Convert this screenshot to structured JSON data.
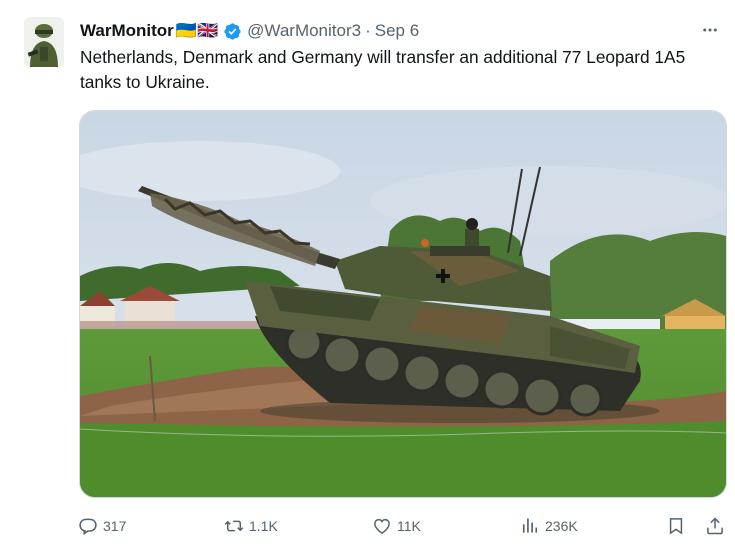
{
  "author": {
    "name": "WarMonitor",
    "flags": "🇺🇦🇬🇧",
    "handle": "@WarMonitor3",
    "separator": "·",
    "date": "Sep 6"
  },
  "tweet": {
    "text": "Netherlands, Denmark and Germany will transfer an additional 77 Leopard 1A5 tanks to Ukraine."
  },
  "metrics": {
    "replies": "317",
    "reposts": "1.1K",
    "likes": "11K",
    "views": "236K"
  },
  "colors": {
    "verified": "#1d9bf0",
    "muted_text": "#536471"
  },
  "icons": {
    "more": "more-icon",
    "reply": "reply-icon",
    "repost": "repost-icon",
    "like": "heart-icon",
    "views": "views-icon",
    "bookmark": "bookmark-icon",
    "share": "share-icon"
  }
}
